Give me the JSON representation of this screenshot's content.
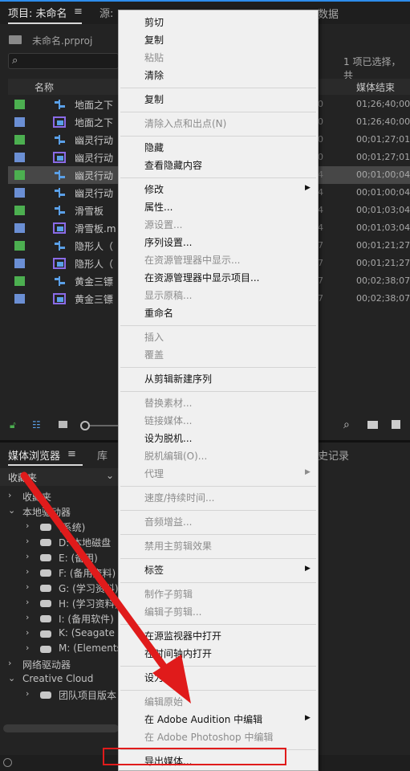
{
  "project_panel": {
    "tab_label": "项目: 未命名",
    "source_tab": "源:",
    "metadata_tab": "数据",
    "project_file": "未命名.prproj",
    "selection_info": "1 项已选择，共",
    "columns": {
      "name": "名称",
      "media_end": "媒体结束"
    },
    "rows": [
      {
        "name": "地面之下",
        "mid": "0",
        "end": "01;26;40;00",
        "color": "#4caf50",
        "icon": "sequence-icon"
      },
      {
        "name": "地面之下",
        "mid": "0",
        "end": "01;26;40;00",
        "color": "#6b8fd4",
        "icon": "clip-icon"
      },
      {
        "name": "幽灵行动",
        "mid": "0",
        "end": "00;01;27;01",
        "color": "#4caf50",
        "icon": "sequence-icon"
      },
      {
        "name": "幽灵行动",
        "mid": "0",
        "end": "00;01;27;01",
        "color": "#6b8fd4",
        "icon": "clip-icon"
      },
      {
        "name": "幽灵行动",
        "mid": "4",
        "end": "00;01;00;04",
        "color": "#4caf50",
        "icon": "sequence-icon"
      },
      {
        "name": "幽灵行动",
        "mid": "4",
        "end": "00;01;00;04",
        "color": "#6b8fd4",
        "icon": "sequence-icon"
      },
      {
        "name": "滑雪板",
        "mid": "4",
        "end": "00;01;03;04",
        "color": "#4caf50",
        "icon": "sequence-icon"
      },
      {
        "name": "滑雪板.m",
        "mid": "4",
        "end": "00;01;03;04",
        "color": "#6b8fd4",
        "icon": "clip-icon"
      },
      {
        "name": "隐形人（",
        "mid": "7",
        "end": "00;01;21;27",
        "color": "#4caf50",
        "icon": "sequence-icon"
      },
      {
        "name": "隐形人（",
        "mid": "7",
        "end": "00;01;21;27",
        "color": "#6b8fd4",
        "icon": "clip-icon"
      },
      {
        "name": "黄金三镖",
        "mid": "7",
        "end": "00;02;38;07",
        "color": "#4caf50",
        "icon": "sequence-icon"
      },
      {
        "name": "黄金三镖",
        "mid": "7",
        "end": "00;02;38;07",
        "color": "#6b8fd4",
        "icon": "clip-icon"
      }
    ],
    "selected_row": 4
  },
  "media_browser": {
    "tab_label": "媒体浏览器",
    "library_tab": "库",
    "history_tab": "史记录",
    "favorites_dropdown": "收藏夹",
    "tree": [
      {
        "label": "收藏夹",
        "indent": 0,
        "twisty": "›",
        "drive": false
      },
      {
        "label": "本地驱动器",
        "indent": 0,
        "twisty": "⌄",
        "drive": false
      },
      {
        "label": "(系统)",
        "indent": 1,
        "twisty": "›",
        "drive": true
      },
      {
        "label": "D: 本地磁盘",
        "indent": 1,
        "twisty": "›",
        "drive": true
      },
      {
        "label": "E: (备用)",
        "indent": 1,
        "twisty": "›",
        "drive": true
      },
      {
        "label": "F: (备用资料)",
        "indent": 1,
        "twisty": "›",
        "drive": true
      },
      {
        "label": "G: (学习资料)",
        "indent": 1,
        "twisty": "›",
        "drive": true
      },
      {
        "label": "H: (学习资料)",
        "indent": 1,
        "twisty": "›",
        "drive": true
      },
      {
        "label": "I: (备用软件)",
        "indent": 1,
        "twisty": "›",
        "drive": true
      },
      {
        "label": "K: (Seagate Ba",
        "indent": 1,
        "twisty": "›",
        "drive": true
      },
      {
        "label": "M: (Elements)",
        "indent": 1,
        "twisty": "›",
        "drive": true
      },
      {
        "label": "网络驱动器",
        "indent": 0,
        "twisty": "›",
        "drive": false
      },
      {
        "label": "Creative Cloud",
        "indent": 0,
        "twisty": "⌄",
        "drive": false
      },
      {
        "label": "团队项目版本",
        "indent": 1,
        "twisty": "›",
        "drive": true
      }
    ]
  },
  "context_menu": {
    "items": [
      {
        "label": "剪切",
        "enabled": true
      },
      {
        "label": "复制",
        "enabled": true
      },
      {
        "label": "粘贴",
        "enabled": false
      },
      {
        "label": "清除",
        "enabled": true
      },
      {
        "sep": true
      },
      {
        "label": "复制",
        "enabled": true
      },
      {
        "sep": true
      },
      {
        "label": "清除入点和出点(N)",
        "enabled": false
      },
      {
        "sep": true
      },
      {
        "label": "隐藏",
        "enabled": true
      },
      {
        "label": "查看隐藏内容",
        "enabled": true
      },
      {
        "sep": true
      },
      {
        "label": "修改",
        "enabled": true,
        "submenu": true
      },
      {
        "label": "属性...",
        "enabled": true
      },
      {
        "label": "源设置...",
        "enabled": false
      },
      {
        "label": "序列设置...",
        "enabled": true
      },
      {
        "label": "在资源管理器中显示...",
        "enabled": false
      },
      {
        "label": "在资源管理器中显示项目...",
        "enabled": true
      },
      {
        "label": "显示原稿...",
        "enabled": false
      },
      {
        "label": "重命名",
        "enabled": true
      },
      {
        "sep": true
      },
      {
        "label": "插入",
        "enabled": false
      },
      {
        "label": "覆盖",
        "enabled": false
      },
      {
        "sep": true
      },
      {
        "label": "从剪辑新建序列",
        "enabled": true
      },
      {
        "sep": true
      },
      {
        "label": "替换素材...",
        "enabled": false
      },
      {
        "label": "链接媒体...",
        "enabled": false
      },
      {
        "label": "设为脱机...",
        "enabled": true
      },
      {
        "label": "脱机编辑(O)...",
        "enabled": false
      },
      {
        "label": "代理",
        "enabled": false,
        "submenu": true
      },
      {
        "sep": true
      },
      {
        "label": "速度/持续时间...",
        "enabled": false
      },
      {
        "sep": true
      },
      {
        "label": "音频增益...",
        "enabled": false
      },
      {
        "sep": true
      },
      {
        "label": "禁用主剪辑效果",
        "enabled": false
      },
      {
        "sep": true
      },
      {
        "label": "标签",
        "enabled": true,
        "submenu": true
      },
      {
        "sep": true
      },
      {
        "label": "制作子剪辑",
        "enabled": false
      },
      {
        "label": "编辑子剪辑...",
        "enabled": false
      },
      {
        "sep": true
      },
      {
        "label": "在源监视器中打开",
        "enabled": true
      },
      {
        "label": "在时间轴内打开",
        "enabled": true
      },
      {
        "sep": true
      },
      {
        "label": "设为帧",
        "enabled": true
      },
      {
        "sep": true
      },
      {
        "label": "编辑原始",
        "enabled": false
      },
      {
        "label": "在 Adobe Audition 中编辑",
        "enabled": true,
        "submenu": true
      },
      {
        "label": "在 Adobe Photoshop 中编辑",
        "enabled": false
      },
      {
        "sep": true
      },
      {
        "label": "导出媒体...",
        "enabled": true
      }
    ]
  },
  "annotation": {
    "color": "#e01b1b"
  }
}
